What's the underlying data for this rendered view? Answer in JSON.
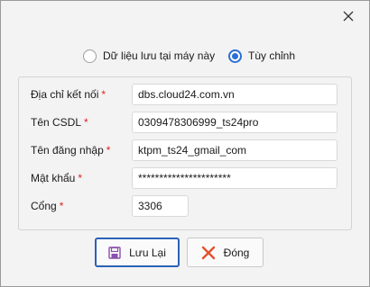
{
  "options": {
    "local_label": "Dữ liệu lưu tại máy này",
    "custom_label": "Tùy chỉnh",
    "selected": "custom"
  },
  "form": {
    "address_label": "Địa chỉ kết nối",
    "address_value": "dbs.cloud24.com.vn",
    "db_label": "Tên CSDL",
    "db_value": "0309478306999_ts24pro",
    "user_label": "Tên đăng nhập",
    "user_value": "ktpm_ts24_gmail_com",
    "password_label": "Mật khẩu",
    "password_value": "**********************",
    "port_label": "Cổng",
    "port_value": "3306",
    "required_mark": "*"
  },
  "buttons": {
    "save_label": "Lưu Lại",
    "close_label": "Đóng"
  },
  "colors": {
    "accent": "#2a6fd6",
    "required": "#e02020",
    "close_icon": "#e5502f",
    "save_icon": "#8a4fb0"
  }
}
